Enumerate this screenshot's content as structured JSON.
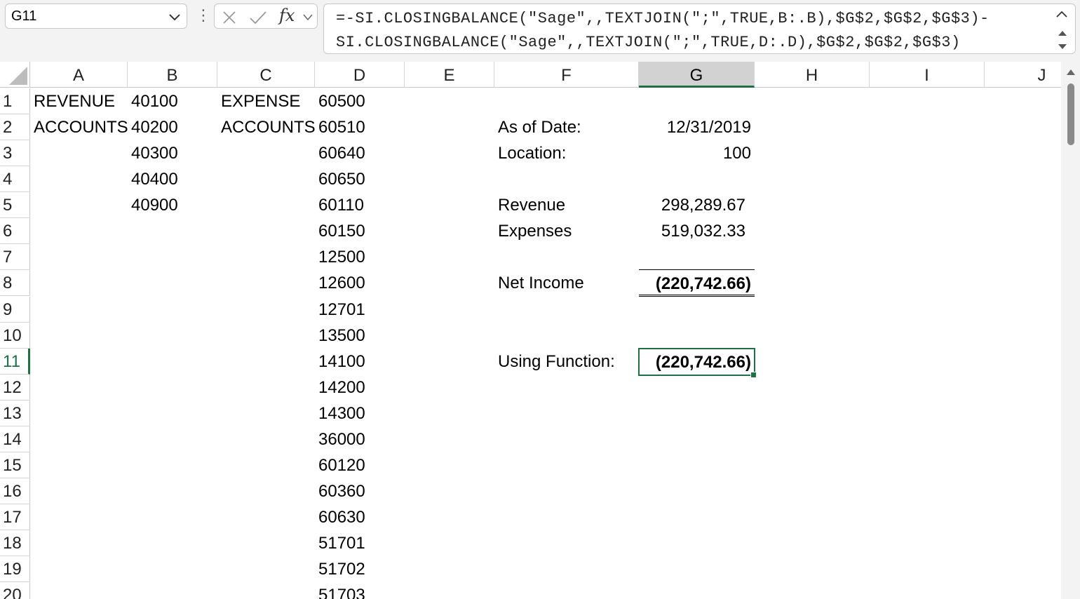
{
  "name_box": {
    "value": "G11"
  },
  "formula_bar": {
    "line1": "=-SI.CLOSINGBALANCE(\"Sage\",,TEXTJOIN(\";\",TRUE,B:.B),$G$2,$G$2,$G$3)-",
    "line2": "SI.CLOSINGBALANCE(\"Sage\",,TEXTJOIN(\";\",TRUE,D:.D),$G$2,$G$2,$G$3)",
    "fx_label": "fx"
  },
  "columns": [
    "A",
    "B",
    "C",
    "D",
    "E",
    "F",
    "G",
    "H",
    "I",
    "J"
  ],
  "rows": [
    "1",
    "2",
    "3",
    "4",
    "5",
    "6",
    "7",
    "8",
    "9",
    "10",
    "11",
    "12",
    "13",
    "14",
    "15",
    "16",
    "17",
    "18",
    "19",
    "20"
  ],
  "selected": {
    "column": "G",
    "row": "11"
  },
  "cells": {
    "A1": "REVENUE",
    "A2": "ACCOUNTS",
    "B1": "40100",
    "B2": "40200",
    "B3": "40300",
    "B4": "40400",
    "B5": "40900",
    "C1": "EXPENSE",
    "C2": "ACCOUNTS",
    "D": [
      "60500",
      "60510",
      "60640",
      "60650",
      "60110",
      "60150",
      "12500",
      "12600",
      "12701",
      "13500",
      "14100",
      "14200",
      "14300",
      "36000",
      "60120",
      "60360",
      "60630",
      "51701",
      "51702",
      "51703"
    ],
    "F2": "As of Date:",
    "G2": "12/31/2019",
    "F3": "Location:",
    "G3": "100",
    "F5": "Revenue",
    "G5": "298,289.67",
    "F6": "Expenses",
    "G6": "519,032.33",
    "F8": "Net Income",
    "G8": "(220,742.66)",
    "F11": "Using Function:",
    "G11": "(220,742.66)"
  },
  "colors": {
    "accent": "#1e7145",
    "header_selected": "#d2d2d2"
  }
}
